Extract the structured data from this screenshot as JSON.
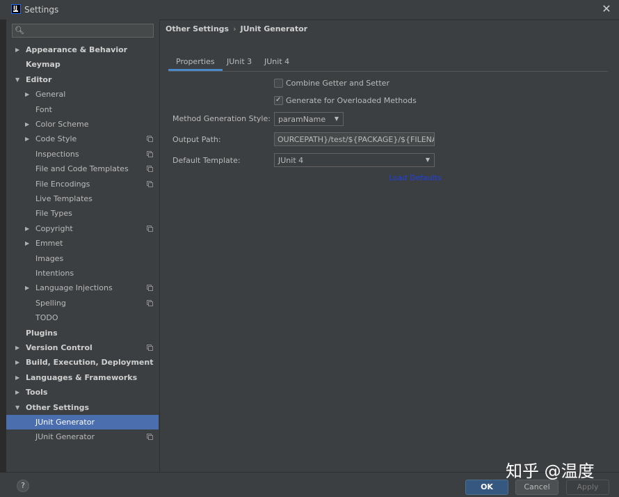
{
  "window": {
    "title": "Settings",
    "app_icon_glyph": "IJ"
  },
  "search": {
    "placeholder": ""
  },
  "sidebar": {
    "items": [
      {
        "label": "Appearance & Behavior",
        "level": 0,
        "arrow": "▶",
        "bold": true,
        "copy_icon": false,
        "selected": false
      },
      {
        "label": "Keymap",
        "level": 0,
        "arrow": "",
        "bold": true,
        "copy_icon": false,
        "selected": false
      },
      {
        "label": "Editor",
        "level": 0,
        "arrow": "▼",
        "bold": true,
        "copy_icon": false,
        "selected": false
      },
      {
        "label": "General",
        "level": 1,
        "arrow": "▶",
        "bold": false,
        "copy_icon": false,
        "selected": false
      },
      {
        "label": "Font",
        "level": 1,
        "arrow": "",
        "bold": false,
        "copy_icon": false,
        "selected": false
      },
      {
        "label": "Color Scheme",
        "level": 1,
        "arrow": "▶",
        "bold": false,
        "copy_icon": false,
        "selected": false
      },
      {
        "label": "Code Style",
        "level": 1,
        "arrow": "▶",
        "bold": false,
        "copy_icon": true,
        "selected": false
      },
      {
        "label": "Inspections",
        "level": 1,
        "arrow": "",
        "bold": false,
        "copy_icon": true,
        "selected": false
      },
      {
        "label": "File and Code Templates",
        "level": 1,
        "arrow": "",
        "bold": false,
        "copy_icon": true,
        "selected": false
      },
      {
        "label": "File Encodings",
        "level": 1,
        "arrow": "",
        "bold": false,
        "copy_icon": true,
        "selected": false
      },
      {
        "label": "Live Templates",
        "level": 1,
        "arrow": "",
        "bold": false,
        "copy_icon": false,
        "selected": false
      },
      {
        "label": "File Types",
        "level": 1,
        "arrow": "",
        "bold": false,
        "copy_icon": false,
        "selected": false
      },
      {
        "label": "Copyright",
        "level": 1,
        "arrow": "▶",
        "bold": false,
        "copy_icon": true,
        "selected": false
      },
      {
        "label": "Emmet",
        "level": 1,
        "arrow": "▶",
        "bold": false,
        "copy_icon": false,
        "selected": false
      },
      {
        "label": "Images",
        "level": 1,
        "arrow": "",
        "bold": false,
        "copy_icon": false,
        "selected": false
      },
      {
        "label": "Intentions",
        "level": 1,
        "arrow": "",
        "bold": false,
        "copy_icon": false,
        "selected": false
      },
      {
        "label": "Language Injections",
        "level": 1,
        "arrow": "▶",
        "bold": false,
        "copy_icon": true,
        "selected": false
      },
      {
        "label": "Spelling",
        "level": 1,
        "arrow": "",
        "bold": false,
        "copy_icon": true,
        "selected": false
      },
      {
        "label": "TODO",
        "level": 1,
        "arrow": "",
        "bold": false,
        "copy_icon": false,
        "selected": false
      },
      {
        "label": "Plugins",
        "level": 0,
        "arrow": "",
        "bold": true,
        "copy_icon": false,
        "selected": false
      },
      {
        "label": "Version Control",
        "level": 0,
        "arrow": "▶",
        "bold": true,
        "copy_icon": true,
        "selected": false
      },
      {
        "label": "Build, Execution, Deployment",
        "level": 0,
        "arrow": "▶",
        "bold": true,
        "copy_icon": false,
        "selected": false
      },
      {
        "label": "Languages & Frameworks",
        "level": 0,
        "arrow": "▶",
        "bold": true,
        "copy_icon": false,
        "selected": false
      },
      {
        "label": "Tools",
        "level": 0,
        "arrow": "▶",
        "bold": true,
        "copy_icon": false,
        "selected": false
      },
      {
        "label": "Other Settings",
        "level": 0,
        "arrow": "▼",
        "bold": true,
        "copy_icon": false,
        "selected": false
      },
      {
        "label": "JUnit Generator",
        "level": 1,
        "arrow": "",
        "bold": false,
        "copy_icon": false,
        "selected": true
      },
      {
        "label": "JUnit Generator",
        "level": 1,
        "arrow": "",
        "bold": false,
        "copy_icon": true,
        "selected": false
      }
    ]
  },
  "breadcrumb": {
    "parent": "Other Settings",
    "separator": "›",
    "current": "JUnit Generator"
  },
  "tabs": [
    {
      "label": "Properties",
      "active": true
    },
    {
      "label": "JUnit 3",
      "active": false
    },
    {
      "label": "JUnit 4",
      "active": false
    }
  ],
  "properties": {
    "combine_getter_setter": {
      "label": "Combine Getter and Setter",
      "checked": false
    },
    "generate_overloaded": {
      "label": "Generate for Overloaded Methods",
      "checked": true
    },
    "method_generation_style": {
      "label": "Method Generation Style:",
      "value": "paramName"
    },
    "output_path": {
      "label": "Output Path:",
      "value": "OURCEPATH}/test/${PACKAGE}/${FILENAME}"
    },
    "default_template": {
      "label": "Default Template:",
      "value": "JUnit 4"
    },
    "load_defaults": "Load Defaults"
  },
  "footer": {
    "help": "?",
    "ok": "OK",
    "cancel": "Cancel",
    "apply": "Apply"
  },
  "watermark": "知乎 @温度",
  "colors": {
    "selection": "#4b6eaf",
    "primary_button": "#365880",
    "tab_underline": "#4a88c7",
    "link": "#1f40e0"
  },
  "icons": {
    "search": "search-icon",
    "close": "close-icon",
    "copy": "copy-icon",
    "chevron": "chevron-down-icon",
    "help": "help-icon"
  }
}
